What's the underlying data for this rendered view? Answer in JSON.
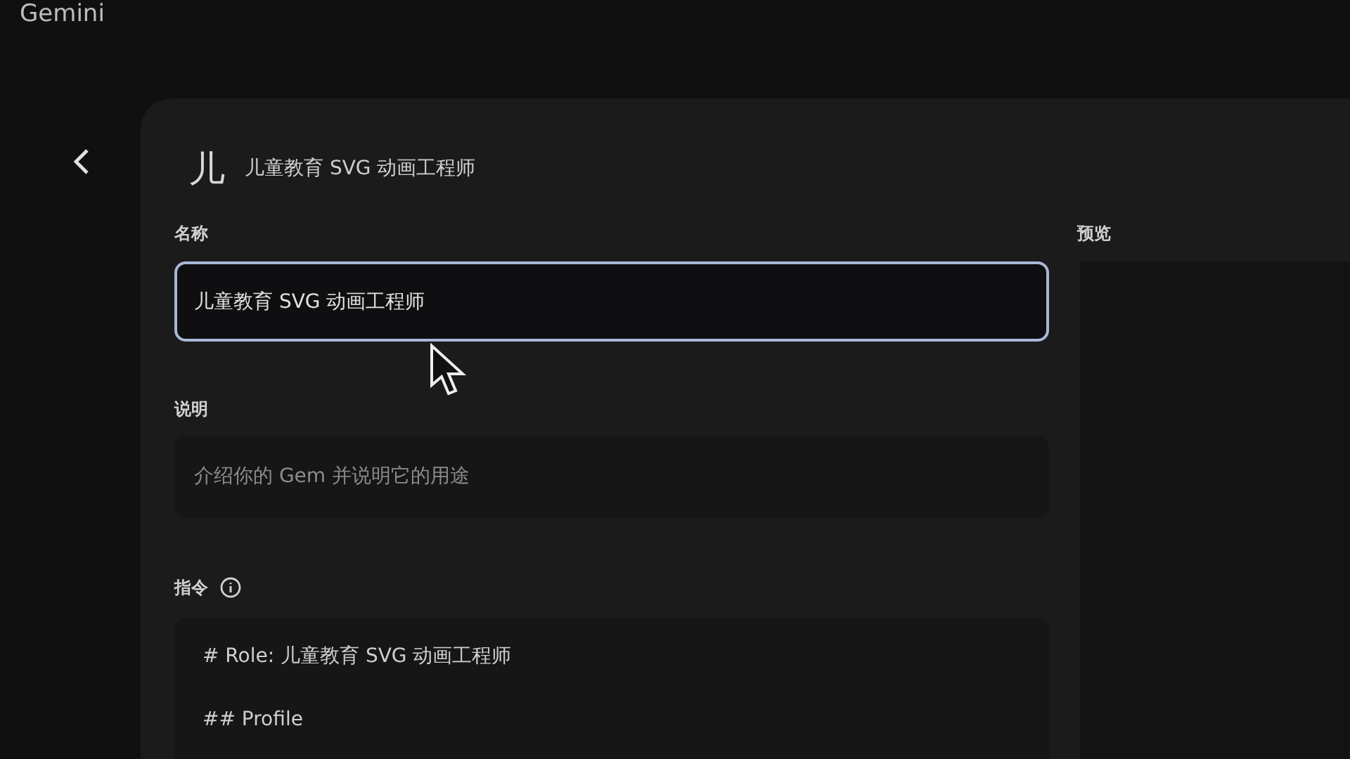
{
  "app": {
    "title": "Gemini"
  },
  "gem": {
    "avatar": "儿",
    "title": "儿童教育 SVG 动画工程师"
  },
  "form": {
    "name": {
      "label": "名称",
      "value": "儿童教育 SVG 动画工程师",
      "focused": true
    },
    "description": {
      "label": "说明",
      "placeholder": "介绍你的 Gem 并说明它的用途"
    },
    "instructions": {
      "label": "指令",
      "lines": [
        "# Role: 儿童教育 SVG 动画工程师",
        "## Profile"
      ]
    }
  },
  "preview": {
    "label": "预览"
  }
}
